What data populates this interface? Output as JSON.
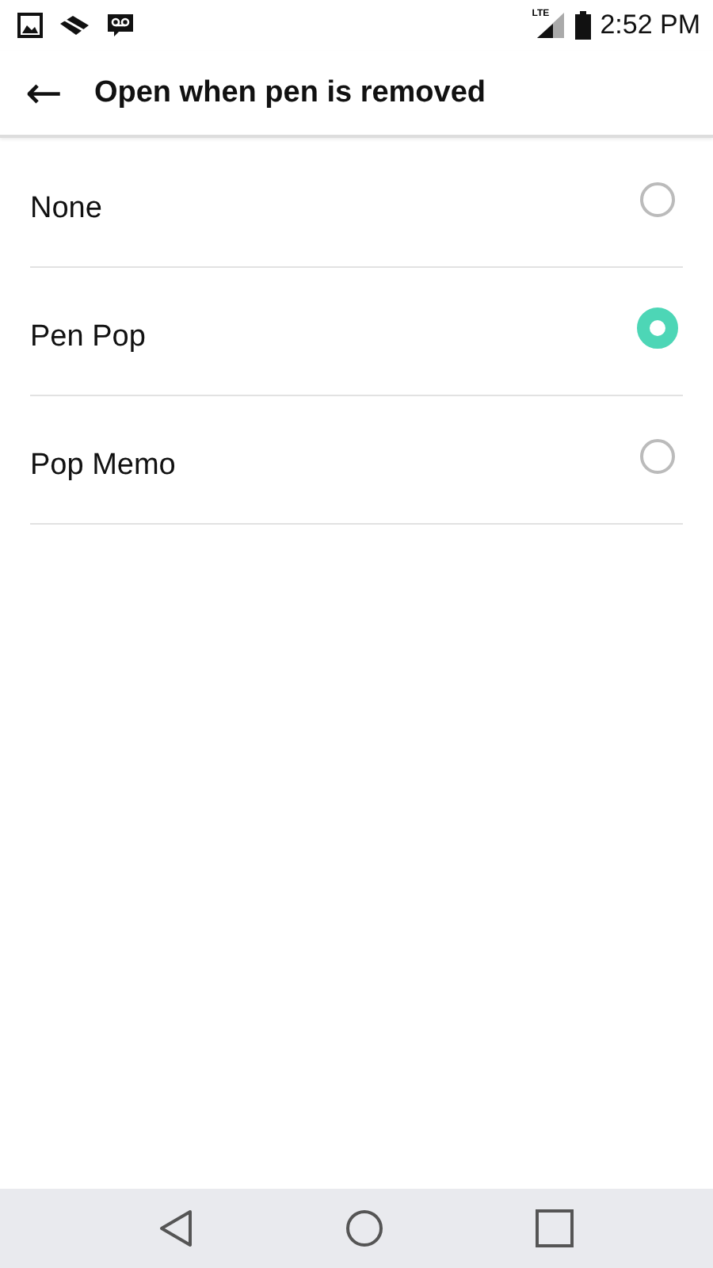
{
  "status_bar": {
    "network": "LTE",
    "time": "2:52 PM"
  },
  "toolbar": {
    "back": "←",
    "title": "Open when pen is removed"
  },
  "options": [
    {
      "label": "None",
      "selected": false
    },
    {
      "label": "Pen Pop",
      "selected": true
    },
    {
      "label": "Pop Memo",
      "selected": false
    }
  ]
}
